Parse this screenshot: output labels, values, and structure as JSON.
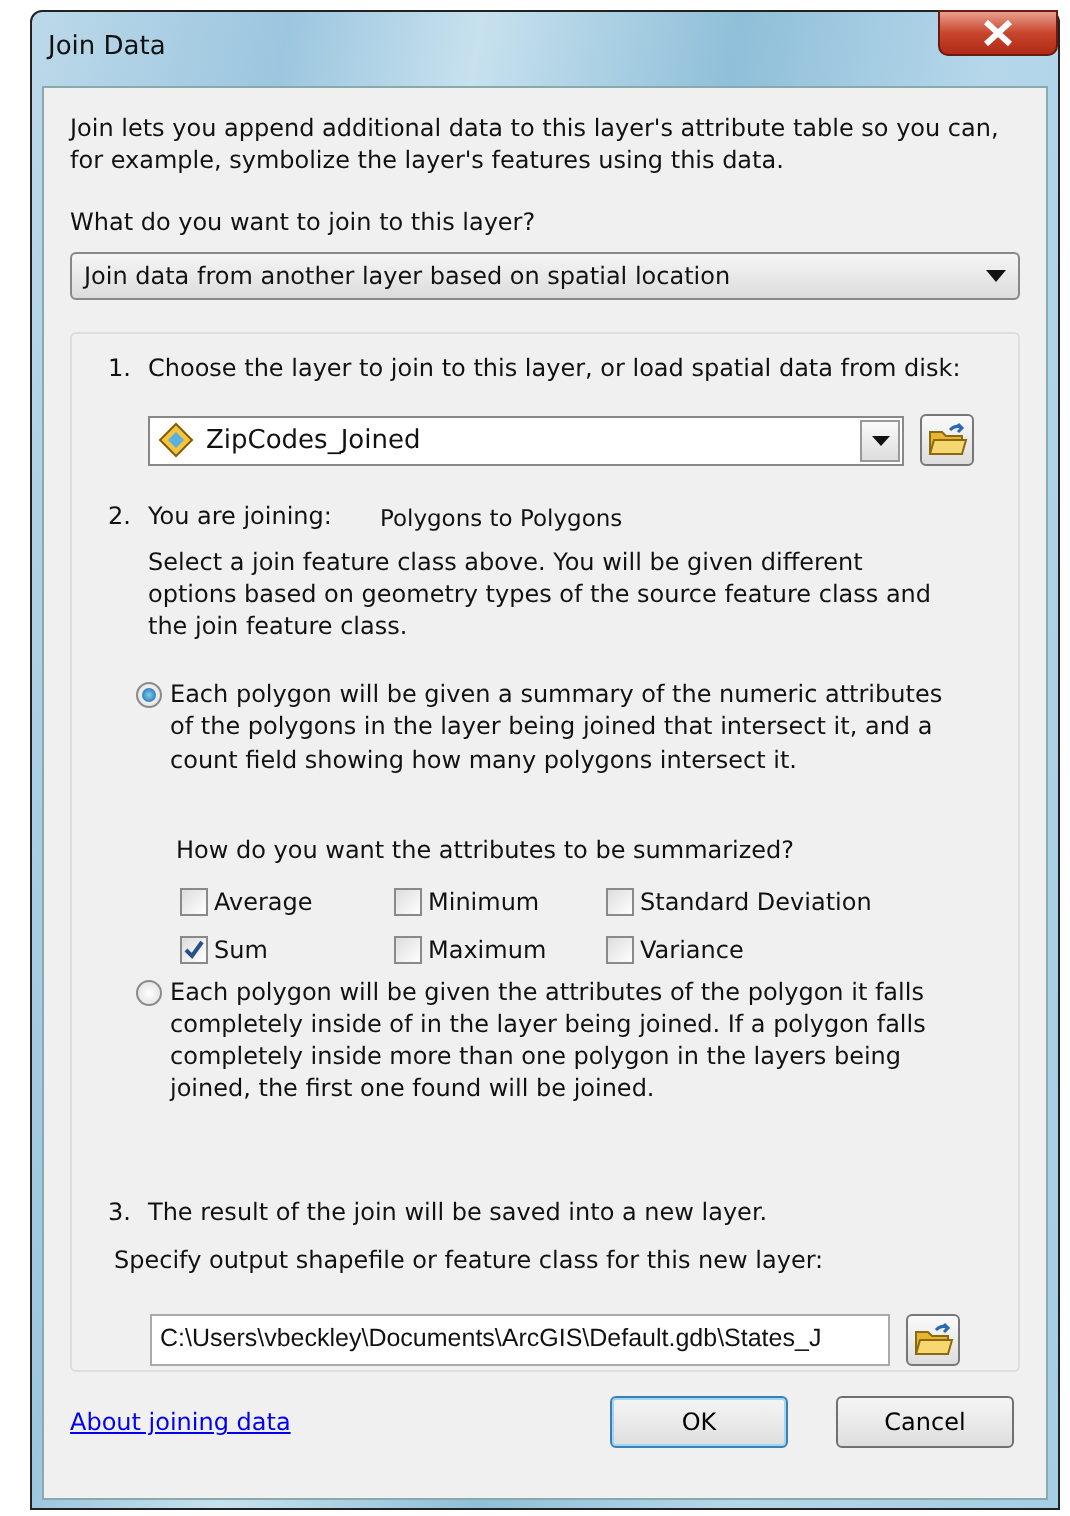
{
  "window": {
    "title": "Join Data"
  },
  "intro": "Join lets you append additional data to this layer's attribute table so you can, for example, symbolize the layer's features using this data.",
  "join_type": {
    "label": "What do you want to join to this layer?",
    "value": "Join data from another layer based on spatial location"
  },
  "step1": {
    "number": "1.",
    "label": "Choose the layer to join to this layer, or load spatial data from disk:",
    "layer": "ZipCodes_Joined"
  },
  "step2": {
    "number": "2.",
    "label": "You are joining:",
    "value": "Polygons to Polygons",
    "description": "Select a join feature class above.  You will be given different options based on geometry types of the source feature class and the join feature class."
  },
  "options": [
    {
      "kind": "summary",
      "selected": true,
      "text": "Each polygon will be given a summary of the numeric attributes of the polygons in the layer being joined that intersect it, and a count field showing how many polygons intersect it.",
      "question": "How do you want the attributes to be summarized?",
      "checkboxes": [
        {
          "label": "Average",
          "checked": false
        },
        {
          "label": "Minimum",
          "checked": false
        },
        {
          "label": "Standard Deviation",
          "checked": false
        },
        {
          "label": "Sum",
          "checked": true
        },
        {
          "label": "Maximum",
          "checked": false
        },
        {
          "label": "Variance",
          "checked": false
        }
      ]
    },
    {
      "kind": "inside",
      "selected": false,
      "text": "Each polygon will be given the attributes of the polygon it falls completely inside of in the layer being joined. If a polygon falls completely inside more than one polygon in the layers being joined, the first one found will be joined."
    }
  ],
  "step3": {
    "number": "3.",
    "label": "The result of the join will be saved into a new layer.",
    "prompt": "Specify output shapefile or feature class for this new layer:",
    "path": "C:\\Users\\vbeckley\\Documents\\ArcGIS\\Default.gdb\\States_J"
  },
  "footer": {
    "link": "About joining data",
    "buttons": [
      {
        "label": "OK",
        "default": true
      },
      {
        "label": "Cancel",
        "default": false
      }
    ]
  }
}
